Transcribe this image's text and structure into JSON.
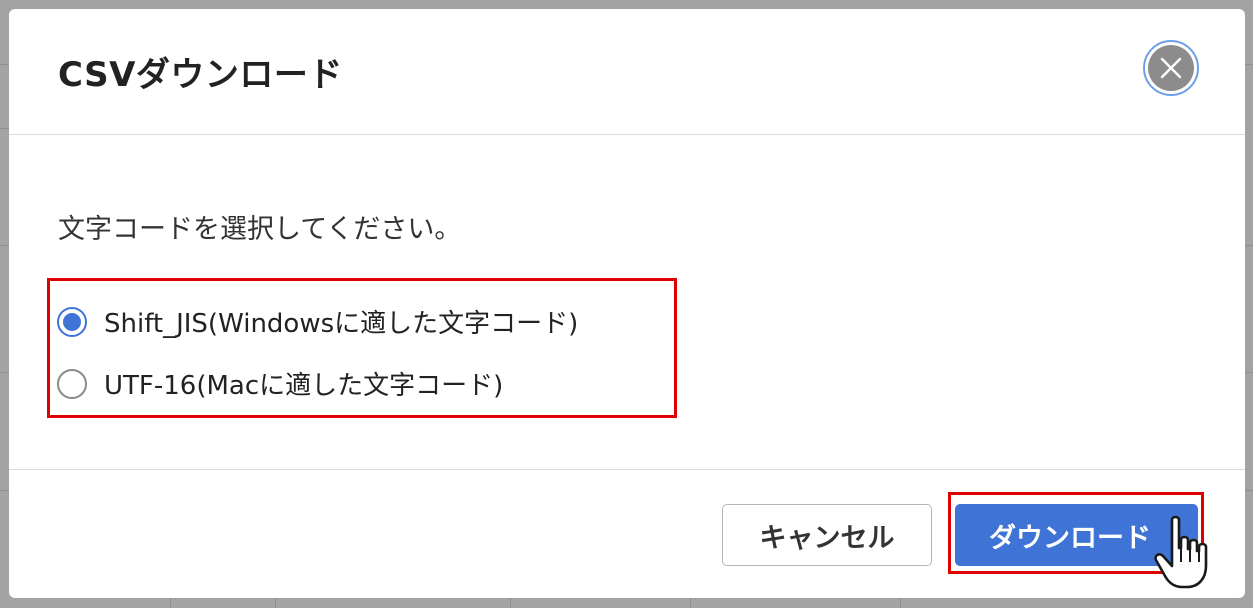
{
  "dialog": {
    "title": "CSVダウンロード",
    "close_icon": "close-icon"
  },
  "body": {
    "instruction": "文字コードを選択してください。",
    "options": [
      {
        "label": "Shift_JIS(Windowsに適した文字コード)",
        "checked": true
      },
      {
        "label": "UTF-16(Macに適した文字コード)",
        "checked": false
      }
    ]
  },
  "footer": {
    "cancel_label": "キャンセル",
    "download_label": "ダウンロード"
  },
  "colors": {
    "accent": "#3f74d6",
    "highlight": "#e00000",
    "close_bg": "#8c8c8c"
  },
  "cursor_icon": "hand-pointer-icon"
}
